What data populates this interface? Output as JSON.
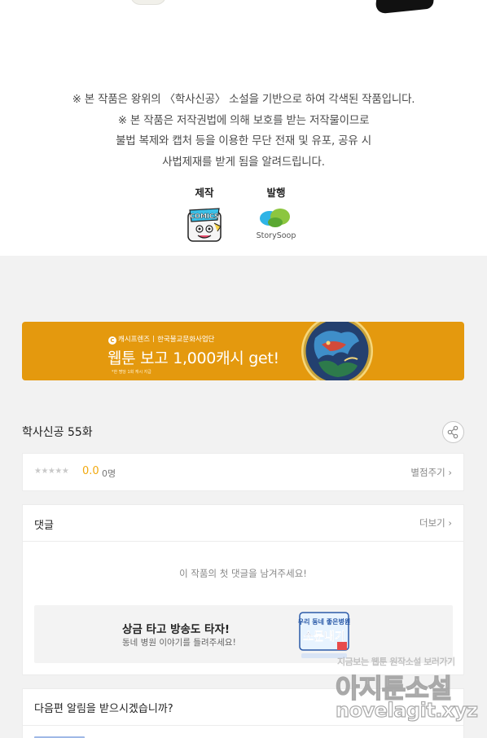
{
  "notice": {
    "lines": [
      "※ 본 작품은 왕위의 〈학사신공〉 소설을 기반으로 하여 각색된 작품입니다.",
      "※ 본 작품은 저작권법에 의해 보호를 받는 저작물이므로",
      "불법 복제와 캡처 등을 이용한 무단 전재 및 유포, 공유 시",
      "사법제재를 받게 됨을 알려드립니다."
    ]
  },
  "credits": {
    "production_label": "제작",
    "production_logo": "comics-logo",
    "publisher_label": "발행",
    "publisher_logo_text": "StorySoop"
  },
  "banner": {
    "brand": "캐시프렌즈",
    "partner": "한국불교문화사업단",
    "headline": "웹툰 보고 1,000캐시 get!",
    "fineprint": "*한 명당 1회 캐시 지급",
    "accent_color": "#e4990e"
  },
  "episode": {
    "title": "학사신공 55화",
    "share_icon": "share-icon"
  },
  "rating": {
    "stars": "★★★★★",
    "score": "0.0",
    "count": "0명",
    "rate_link": "별점주기",
    "score_color": "#f1a90f"
  },
  "comments": {
    "title": "댓글",
    "more_link": "더보기",
    "empty_message": "이 작품의 첫 댓글을 남겨주세요!",
    "promo": {
      "title": "상금 타고 방송도 타자!",
      "subtitle": "동네 병원 이야기를 들려주세요!",
      "art_text": "소문내기",
      "art_text_small": "우리 동네 좋은병원"
    }
  },
  "notify": {
    "title": "다음편 알림을 받으시겠습니까?"
  },
  "watermark": {
    "tagline": "지금보는 웹툰 원작소설 보러가기",
    "site_name": "아지툰소설",
    "url": "novelagit.xyz"
  }
}
